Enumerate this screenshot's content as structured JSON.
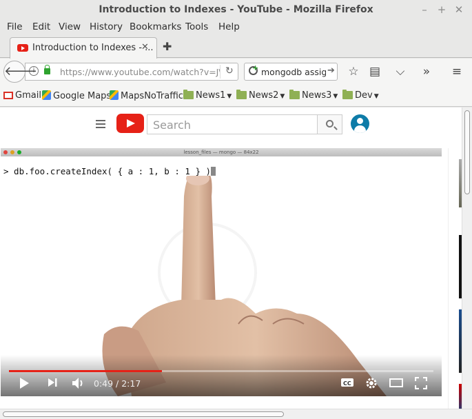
{
  "window": {
    "title": "Introduction to Indexes - YouTube - Mozilla Firefox"
  },
  "menubar": {
    "items": [
      "File",
      "Edit",
      "View",
      "History",
      "Bookmarks",
      "Tools",
      "Help"
    ]
  },
  "tabs": [
    {
      "label": "Introduction to Indexes - ...",
      "active": true
    }
  ],
  "navbar": {
    "url": "https://www.youtube.com/watch?v=J\\",
    "search_value": "mongodb assign"
  },
  "bookmarks": [
    {
      "label": "Gmail",
      "icon": "gmail-icon",
      "folder": false
    },
    {
      "label": "Google Maps",
      "icon": "maps-icon",
      "folder": false
    },
    {
      "label": "MapsNoTraffic",
      "icon": "maps-icon",
      "folder": false
    },
    {
      "label": "News1",
      "icon": "folder-icon",
      "folder": true
    },
    {
      "label": "News2",
      "icon": "folder-icon",
      "folder": true
    },
    {
      "label": "News3",
      "icon": "folder-icon",
      "folder": true
    },
    {
      "label": "Dev",
      "icon": "folder-icon",
      "folder": true
    }
  ],
  "youtube": {
    "search_placeholder": "Search"
  },
  "video": {
    "terminal_title": "lesson_files — mongo — 84x22",
    "terminal_command": "> db.foo.createIndex( { a : 1, b : 1 } )",
    "current_time": "0:49",
    "duration": "2:17",
    "time_display": "0:49 / 2:17",
    "progress_fraction": 0.36,
    "colors": {
      "progress": "#e62117",
      "brand": "#e62117"
    }
  }
}
